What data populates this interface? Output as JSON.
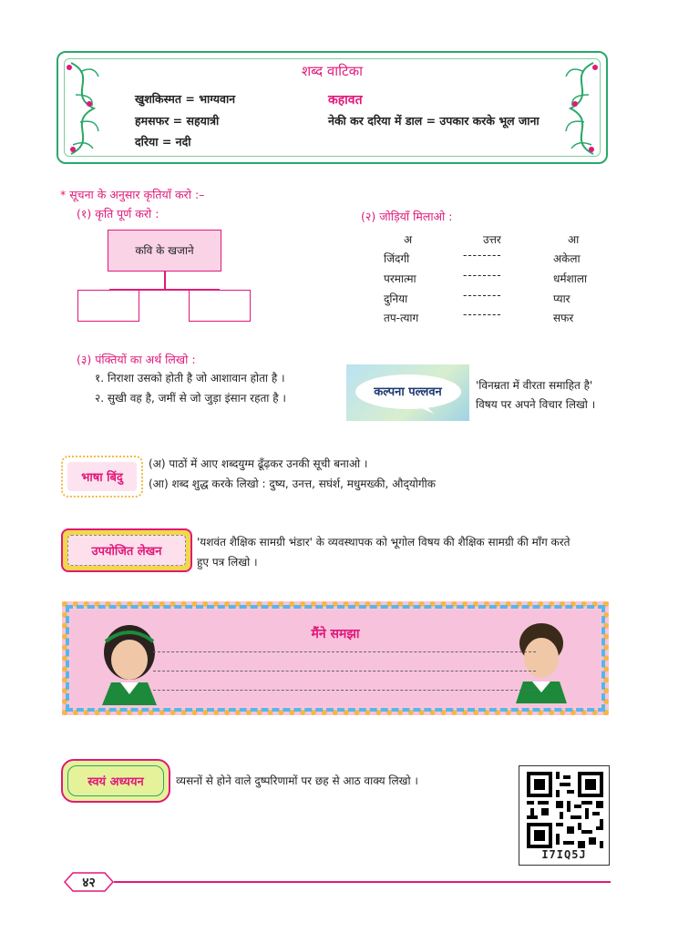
{
  "vocab_box": {
    "title": "शब्द वाटिका",
    "words": [
      "खुशकिस्मत = भाग्यवान",
      "हमसफर = सहयात्री",
      "दरिया = नदी"
    ],
    "proverb_heading": "कहावत",
    "proverb": "नेकी कर दरिया में डाल = उपकार करके भूल जाना"
  },
  "instructions": "* सूचना के अनुसार कृतियाँ करो :–",
  "task1": {
    "heading": "(१) कृति पूर्ण करो :",
    "center_label": "कवि के खजाने"
  },
  "task2": {
    "heading": "(२) जोड़ियाँ मिलाओ :",
    "col_a": "अ",
    "col_answer": "उत्तर",
    "col_aa": "आ",
    "left": [
      "जिंदगी",
      "परमात्मा",
      "दुनिया",
      "तप-त्याग"
    ],
    "answer_blank": "--------",
    "right": [
      "अकेला",
      "धर्मशाला",
      "प्यार",
      "सफर"
    ]
  },
  "task3": {
    "heading": "(३) पंक्तियों का अर्थ लिखो :",
    "lines": [
      "१.  निराशा उसको होती है जो आशावान होता है ।",
      "२. सुखी वह है, जमीं से जो जुड़ा इंसान रहता  है ।"
    ]
  },
  "kalpana": {
    "badge": "कल्पना पल्लवन",
    "line1": "'विनम्रता में वीरता समाहित है'",
    "line2": "विषय पर अपने विचार लिखो ।"
  },
  "bhasha": {
    "badge": "भाषा बिंदु",
    "a": "(अ) पाठों में आए शब्दयुग्म ढूँढ़कर उनकी सूची बनाओ ।",
    "aa": "(आ) शब्द शुद्ध करके लिखो : दुष्य, उनत्त, सघंर्श, मधुमख्की, औद्‌योगीक"
  },
  "upyojit": {
    "badge": "उपयोजित लेखन",
    "text1": "'यशवंत शैक्षिक सामग्री भंडार' के व्यवस्थापक को भूगोल विषय की शैक्षिक सामग्री की माँग करते",
    "text2": "हुए पत्र लिखो ।"
  },
  "samjha": {
    "title": "मैंने समझा"
  },
  "swayam": {
    "badge": "स्वयं अध्ययन",
    "text": "व्यसनों से होने वाले दुष्परिणामों पर छह से आठ वाक्य लिखो ।"
  },
  "qr": {
    "code": "I7IQ5J"
  },
  "page_number": "४२",
  "colors": {
    "accent": "#e0197a",
    "vine": "#2aa86a",
    "samjha_bg": "#f9c5dd"
  }
}
